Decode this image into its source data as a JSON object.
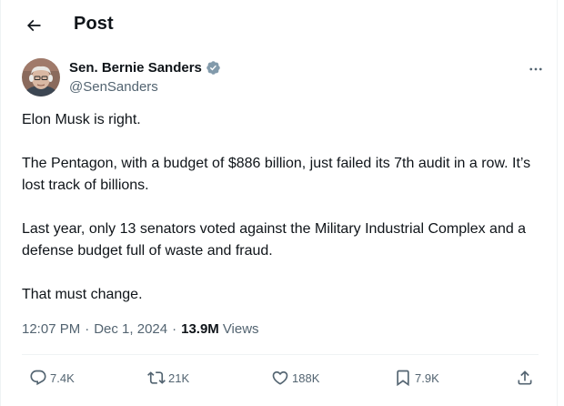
{
  "header": {
    "title": "Post",
    "back_icon": "arrow-left-icon"
  },
  "author": {
    "display_name": "Sen. Bernie Sanders",
    "handle": "@SenSanders",
    "verified_color": "#829aab"
  },
  "tweet": {
    "paragraphs": [
      "Elon Musk is right.",
      "The Pentagon, with a budget of $886 billion, just failed its 7th audit in a row. It’s lost track of billions.",
      "Last year, only 13 senators voted against the Military Industrial Complex and a defense budget full of waste and fraud.",
      "That must change."
    ]
  },
  "meta": {
    "time": "12:07 PM",
    "separator": "·",
    "date": "Dec 1, 2024",
    "views_count": "13.9M",
    "views_label": "Views"
  },
  "actions": {
    "reply": {
      "icon": "reply-icon",
      "count": "7.4K"
    },
    "repost": {
      "icon": "repost-icon",
      "count": "21K"
    },
    "like": {
      "icon": "heart-icon",
      "count": "188K"
    },
    "bookmark": {
      "icon": "bookmark-icon",
      "count": "7.9K"
    },
    "share": {
      "icon": "share-icon"
    }
  },
  "colors": {
    "text": "#0f1419",
    "secondary": "#536471",
    "border": "#eff3f4"
  }
}
